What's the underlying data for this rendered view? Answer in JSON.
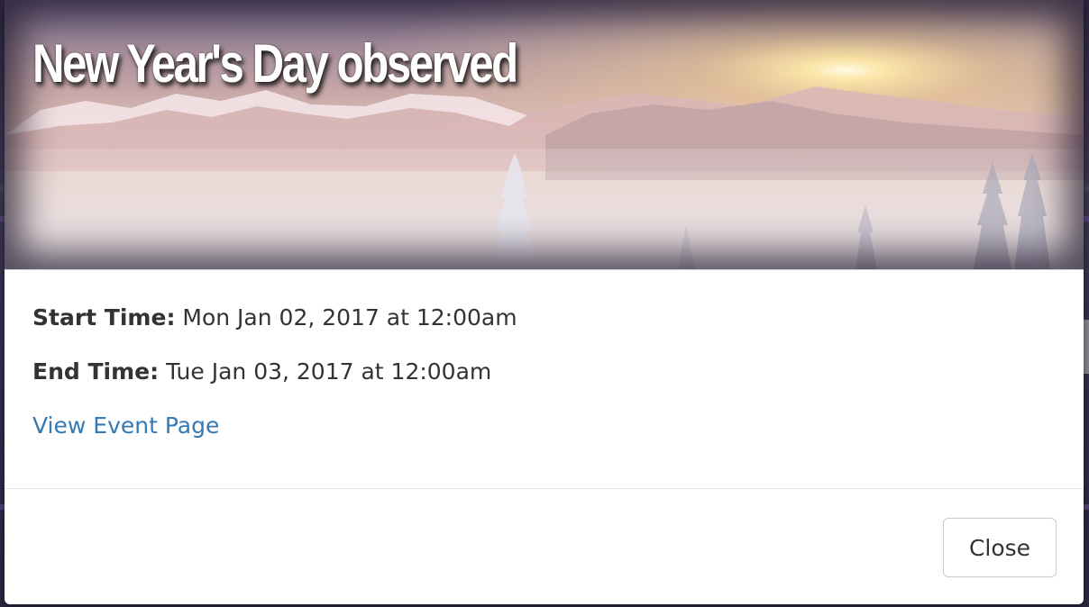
{
  "modal": {
    "title": "New Year's Day observed",
    "start_label": "Start Time:",
    "start_value": "Mon Jan 02, 2017 at 12:00am",
    "end_label": "End Time:",
    "end_value": "Tue Jan 03, 2017 at 12:00am",
    "link_label": "View Event Page",
    "close_label": "Close"
  },
  "colors": {
    "link": "#337ab7",
    "text": "#333333",
    "backdrop": "#3a3450"
  }
}
